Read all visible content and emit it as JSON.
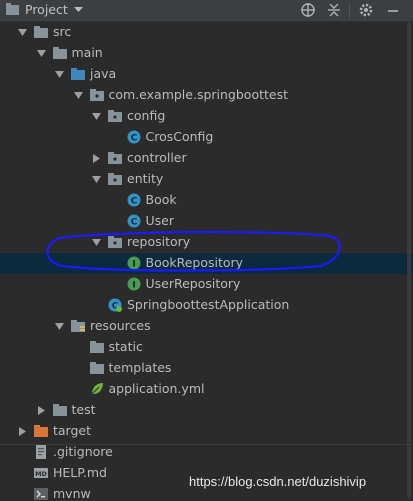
{
  "header": {
    "title": "Project",
    "icons": [
      "crosshair-icon",
      "collapse-icon",
      "gear-icon",
      "minimize-icon"
    ]
  },
  "tree": {
    "items": [
      {
        "label": "src",
        "icon": "folder"
      },
      {
        "label": "main",
        "icon": "folder"
      },
      {
        "label": "java",
        "icon": "source-folder"
      },
      {
        "label": "com.example.springboottest",
        "icon": "package"
      },
      {
        "label": "config",
        "icon": "package"
      },
      {
        "label": "CrosConfig",
        "icon": "class"
      },
      {
        "label": "controller",
        "icon": "package"
      },
      {
        "label": "entity",
        "icon": "package"
      },
      {
        "label": "Book",
        "icon": "class"
      },
      {
        "label": "User",
        "icon": "class"
      },
      {
        "label": "repository",
        "icon": "package"
      },
      {
        "label": "BookRepository",
        "icon": "interface"
      },
      {
        "label": "UserRepository",
        "icon": "interface"
      },
      {
        "label": "SpringboottestApplication",
        "icon": "spring-class"
      },
      {
        "label": "resources",
        "icon": "resources-folder"
      },
      {
        "label": "static",
        "icon": "folder"
      },
      {
        "label": "templates",
        "icon": "folder"
      },
      {
        "label": "application.yml",
        "icon": "yml"
      },
      {
        "label": "test",
        "icon": "folder"
      },
      {
        "label": "target",
        "icon": "excluded-folder"
      },
      {
        "label": ".gitignore",
        "icon": "gitignore"
      },
      {
        "label": "HELP.md",
        "icon": "markdown"
      },
      {
        "label": "mvnw",
        "icon": "script"
      }
    ]
  },
  "watermark": "https://blog.csdn.net/duzishivip",
  "colors": {
    "background": "#2b2b2b",
    "selection": "#0d293e",
    "annotation": "#1a1aff",
    "class_icon": "#3592c4",
    "interface_icon": "#499c54",
    "folder": "#87939a",
    "excluded_folder": "#d9773a"
  }
}
